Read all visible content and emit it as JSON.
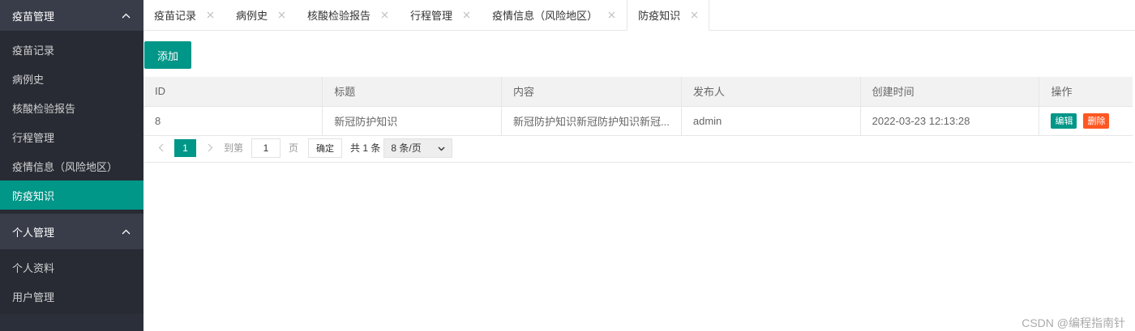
{
  "sidebar": {
    "group1": {
      "title": "疫苗管理",
      "items": [
        {
          "label": "疫苗记录"
        },
        {
          "label": "病例史"
        },
        {
          "label": "核酸检验报告"
        },
        {
          "label": "行程管理"
        },
        {
          "label": "疫情信息（风险地区）"
        },
        {
          "label": "防疫知识"
        }
      ],
      "active_index": 5
    },
    "group2": {
      "title": "个人管理",
      "items": [
        {
          "label": "个人资料"
        },
        {
          "label": "用户管理"
        }
      ]
    }
  },
  "tabs": [
    {
      "label": "疫苗记录"
    },
    {
      "label": "病例史"
    },
    {
      "label": "核酸检验报告"
    },
    {
      "label": "行程管理"
    },
    {
      "label": "疫情信息（风险地区）"
    },
    {
      "label": "防疫知识"
    }
  ],
  "toolbar": {
    "add_label": "添加"
  },
  "table": {
    "columns": [
      "ID",
      "标题",
      "内容",
      "发布人",
      "创建时间",
      "操作"
    ],
    "rows": [
      {
        "id": "8",
        "title": "新冠防护知识",
        "content": "新冠防护知识新冠防护知识新冠...",
        "publisher": "admin",
        "created": "2022-03-23 12:13:28",
        "edit_label": "编辑",
        "delete_label": "删除"
      }
    ]
  },
  "pager": {
    "current": "1",
    "goto_label": "到第",
    "page_input_value": "1",
    "page_unit": "页",
    "confirm_label": "确定",
    "total_label": "共 1 条",
    "page_size_selected": "8 条/页"
  },
  "watermark": "CSDN @编程指南针",
  "colors": {
    "accent": "#009688",
    "danger": "#ff5722",
    "sidebar_bg": "#2b2f3a"
  }
}
